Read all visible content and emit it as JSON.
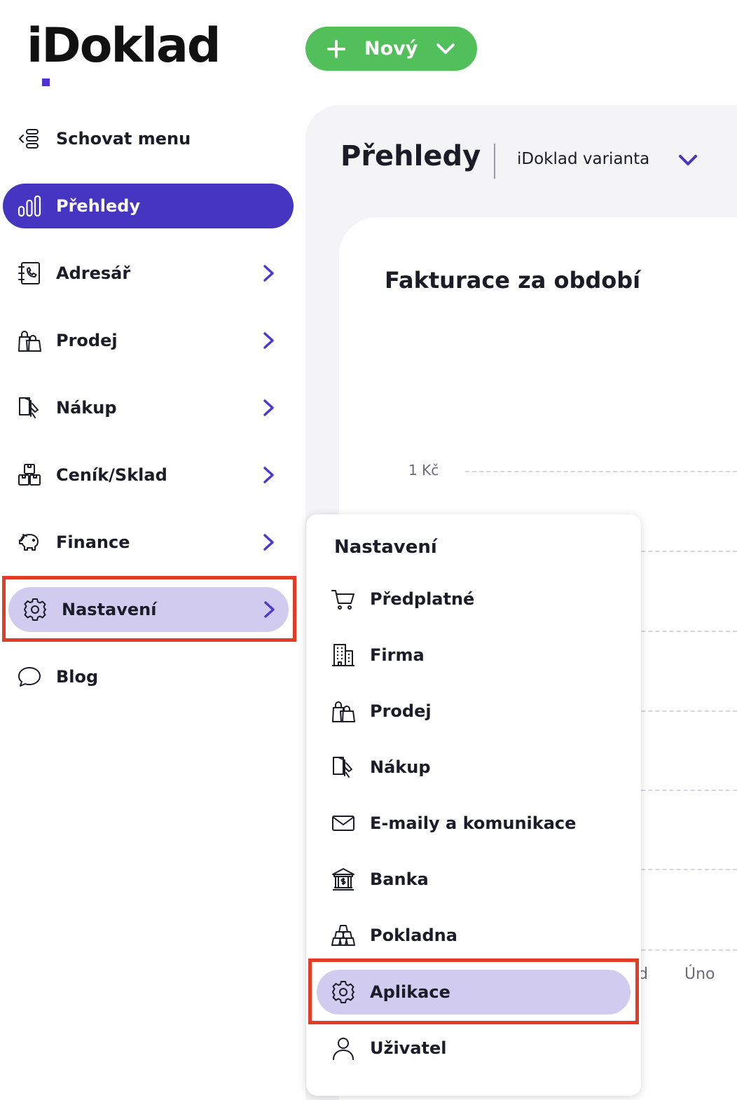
{
  "header": {
    "logo": "iDoklad",
    "new_button": "Nový"
  },
  "sidebar": {
    "items": [
      {
        "label": "Schovat menu",
        "icon": "collapse-menu-icon"
      },
      {
        "label": "Přehledy",
        "icon": "bar-chart-icon",
        "state": "active"
      },
      {
        "label": "Adresář",
        "icon": "address-book-icon",
        "has_submenu": true
      },
      {
        "label": "Prodej",
        "icon": "shopping-bags-icon",
        "has_submenu": true
      },
      {
        "label": "Nákup",
        "icon": "purchase-icon",
        "has_submenu": true
      },
      {
        "label": "Ceník/Sklad",
        "icon": "boxes-icon",
        "has_submenu": true
      },
      {
        "label": "Finance",
        "icon": "piggy-bank-icon",
        "has_submenu": true
      },
      {
        "label": "Nastavení",
        "icon": "gear-icon",
        "has_submenu": true,
        "state": "hover-highlighted"
      },
      {
        "label": "Blog",
        "icon": "chat-bubble-icon"
      }
    ]
  },
  "main": {
    "title": "Přehledy",
    "variant": "iDoklad varianta",
    "card_title": "Fakturace za období",
    "chart_data": {
      "type": "bar",
      "title": "Fakturace za období",
      "y_tick_labels": [
        "1 Kč"
      ],
      "x_tick_labels": [
        "d",
        "Úno"
      ],
      "grid": "dashed-horizontal"
    }
  },
  "settings_menu": {
    "title": "Nastavení",
    "items": [
      {
        "label": "Předplatné",
        "icon": "shopping-cart-icon"
      },
      {
        "label": "Firma",
        "icon": "building-icon"
      },
      {
        "label": "Prodej",
        "icon": "shopping-bags-icon"
      },
      {
        "label": "Nákup",
        "icon": "purchase-icon"
      },
      {
        "label": "E-maily a komunikace",
        "icon": "envelope-icon"
      },
      {
        "label": "Banka",
        "icon": "bank-icon"
      },
      {
        "label": "Pokladna",
        "icon": "cash-stack-icon"
      },
      {
        "label": "Aplikace",
        "icon": "gear-icon",
        "state": "hover-highlighted"
      },
      {
        "label": "Uživatel",
        "icon": "user-icon"
      }
    ]
  },
  "colors": {
    "brand_purple": "#4535c1",
    "hover_lavender": "#d1ccef",
    "new_button_green": "#51bf5a",
    "highlight_red": "#e23b26",
    "chevron_purple": "#4a3bd0"
  }
}
